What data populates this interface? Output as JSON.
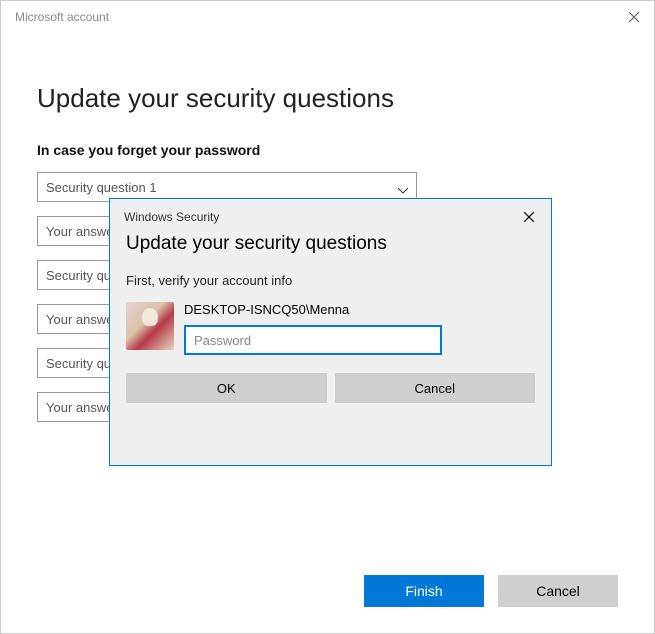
{
  "window": {
    "title": "Microsoft account"
  },
  "page": {
    "heading": "Update your security questions",
    "subheading": "In case you forget your password",
    "fields": {
      "q1": "Security question 1",
      "a1": "Your answer",
      "q2": "Security question 2",
      "a2": "Your answer",
      "q3": "Security question 3",
      "a3": "Your answer"
    },
    "finish": "Finish",
    "cancel": "Cancel"
  },
  "modal": {
    "title": "Windows Security",
    "heading": "Update your security questions",
    "sub": "First, verify your account info",
    "account": "DESKTOP-ISNCQ50\\Menna",
    "password_placeholder": "Password",
    "ok": "OK",
    "cancel": "Cancel"
  }
}
